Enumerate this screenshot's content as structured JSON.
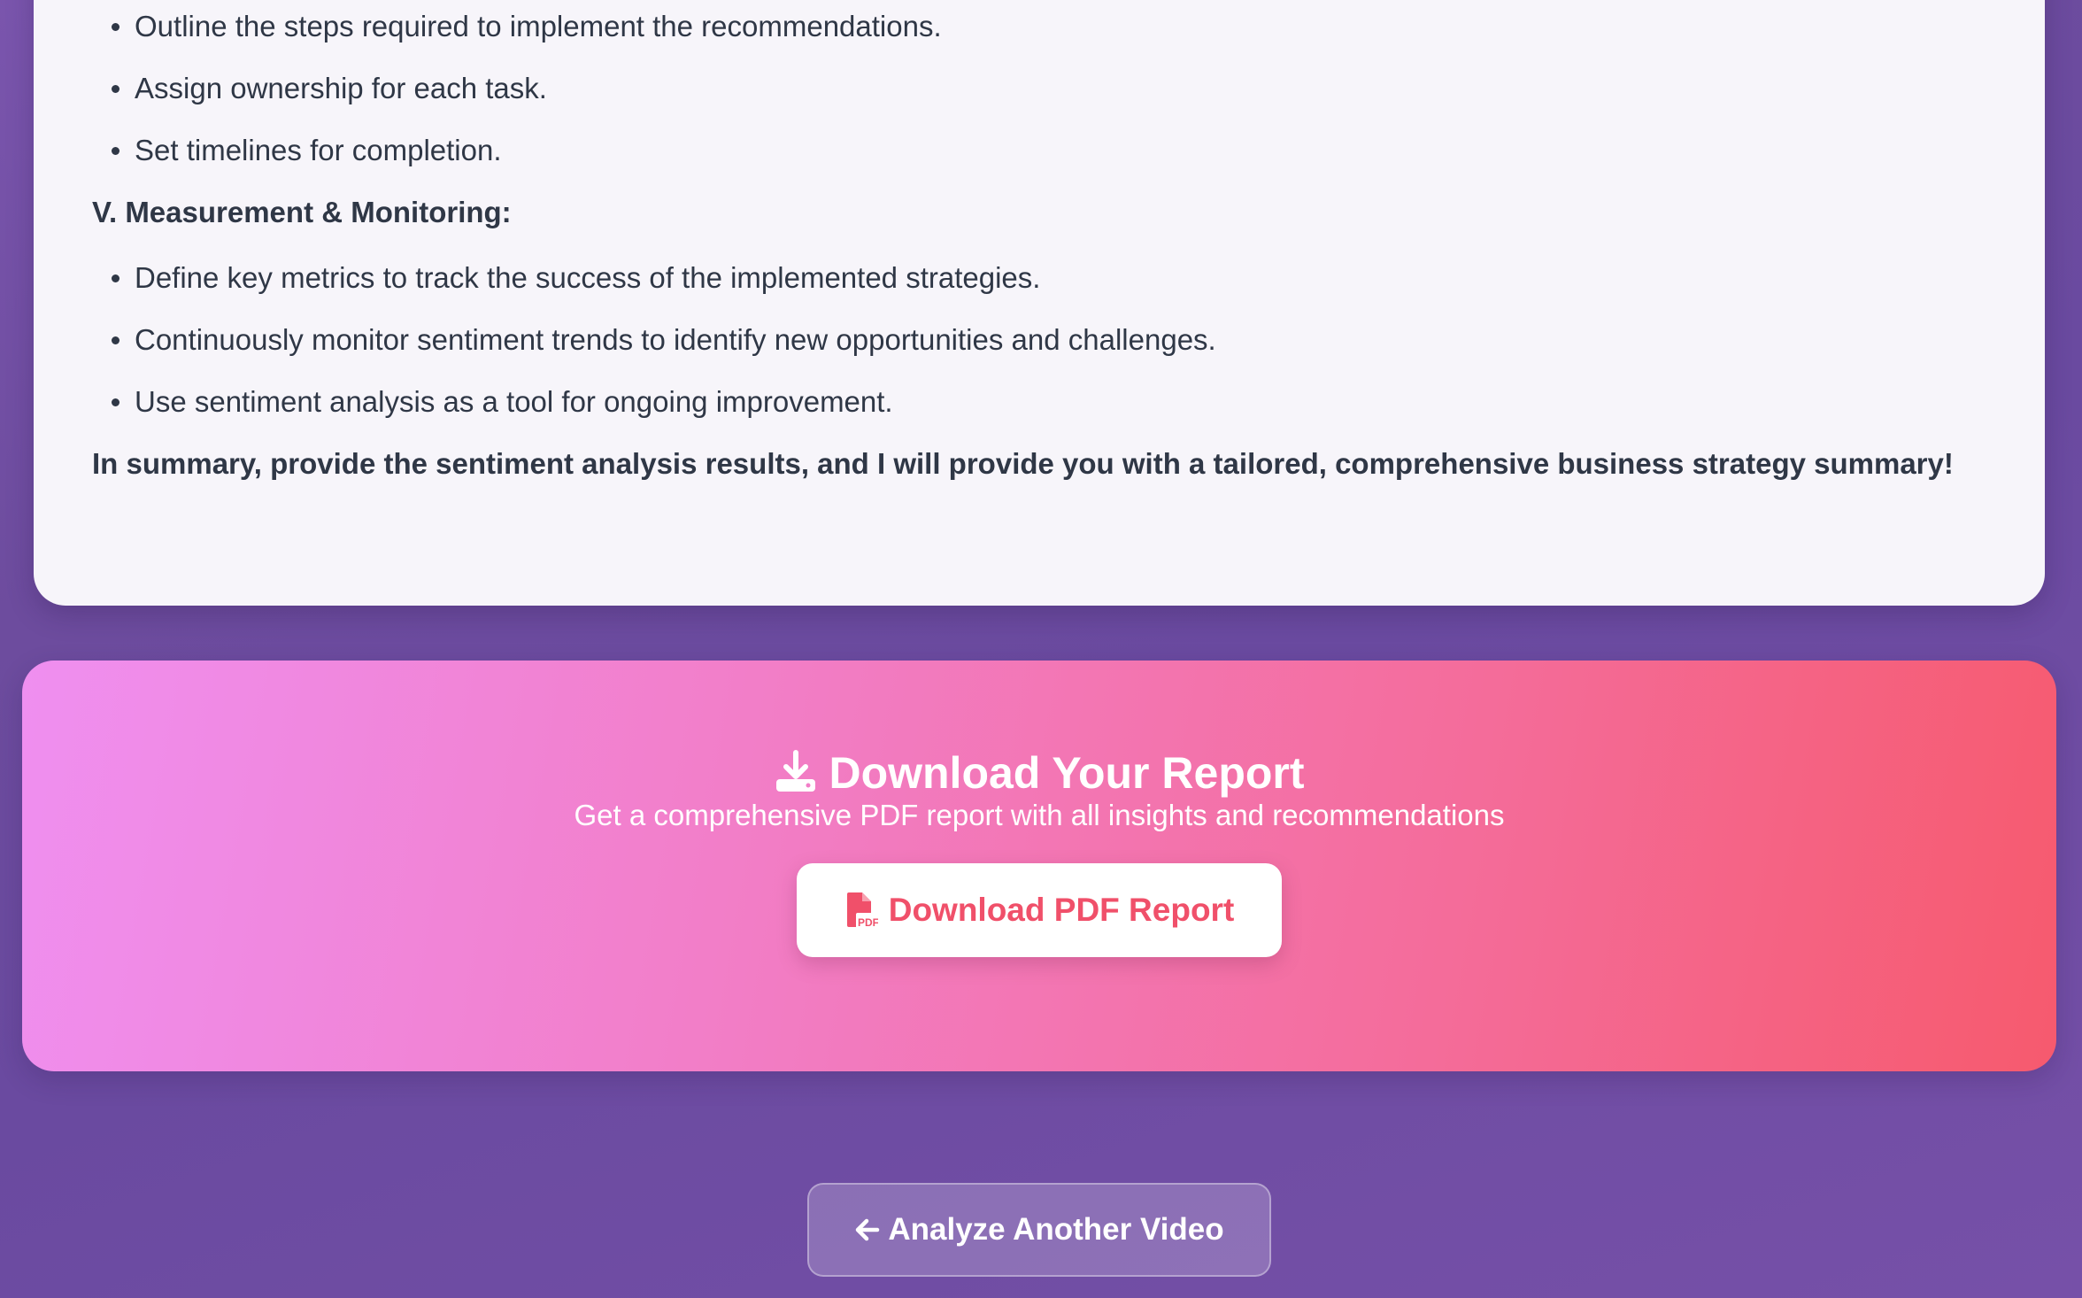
{
  "strategy": {
    "implementation_items": [
      "Outline the steps required to implement the recommendations.",
      "Assign ownership for each task.",
      "Set timelines for completion."
    ],
    "measurement_heading": "V. Measurement & Monitoring:",
    "measurement_items": [
      "Define key metrics to track the success of the implemented strategies.",
      "Continuously monitor sentiment trends to identify new opportunities and challenges.",
      "Use sentiment analysis as a tool for ongoing improvement."
    ],
    "summary": "In summary, provide the sentiment analysis results, and I will provide you with a tailored, comprehensive business strategy summary!"
  },
  "download": {
    "icon": "download-icon",
    "title": "Download Your Report",
    "subtitle": "Get a comprehensive PDF report with all insights and recommendations",
    "button_icon": "pdf-file-icon",
    "button_label": "Download PDF Report"
  },
  "back": {
    "icon": "arrow-left-icon",
    "label": "Analyze Another Video"
  },
  "colors": {
    "background": "#6d4c9e",
    "card": "#f7f5fa",
    "text": "#2f3746",
    "accent": "#f0506a",
    "gradient_start": "#ef8ff0",
    "gradient_end": "#f65a6e"
  }
}
